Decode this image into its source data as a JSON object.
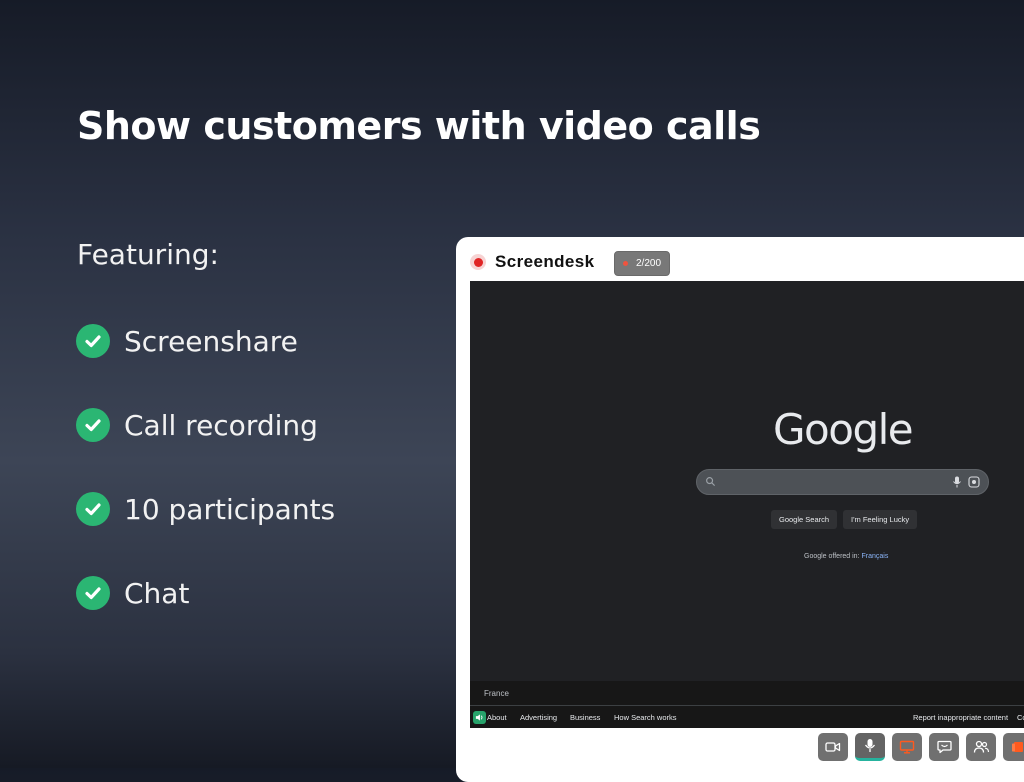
{
  "headline": "Show customers with video calls",
  "featuring_label": "Featuring:",
  "features": [
    {
      "label": "Screenshare",
      "icon": "check-circle-icon"
    },
    {
      "label": "Call recording",
      "icon": "check-circle-icon"
    },
    {
      "label": "10 participants",
      "icon": "check-circle-icon"
    },
    {
      "label": "Chat",
      "icon": "check-circle-icon"
    }
  ],
  "colors": {
    "check": "#2bb673",
    "record": "#e02424",
    "accent": "#26b39e"
  },
  "app": {
    "name": "Screendesk",
    "recording_badge": "2/200",
    "icon": "record-icon"
  },
  "shared_screen": {
    "google_logo": "Google",
    "search_placeholder": "",
    "buttons": [
      "Google Search",
      "I'm Feeling Lucky"
    ],
    "offered_in_prefix": "Google offered in:",
    "offered_in_language": "Français",
    "country": "France",
    "footer_links_left": [
      "About",
      "Advertising",
      "Business",
      "How Search works"
    ],
    "footer_links_right": [
      "Report inappropriate content",
      "Co"
    ]
  },
  "controls": [
    {
      "name": "camera-button",
      "icon": "video-camera-icon"
    },
    {
      "name": "microphone-button",
      "icon": "microphone-icon",
      "active": true
    },
    {
      "name": "screenshare-button",
      "icon": "screen-share-icon"
    },
    {
      "name": "chat-button",
      "icon": "chat-icon"
    },
    {
      "name": "participants-button",
      "icon": "people-icon"
    },
    {
      "name": "end-call-button",
      "icon": "end-call-icon"
    }
  ]
}
